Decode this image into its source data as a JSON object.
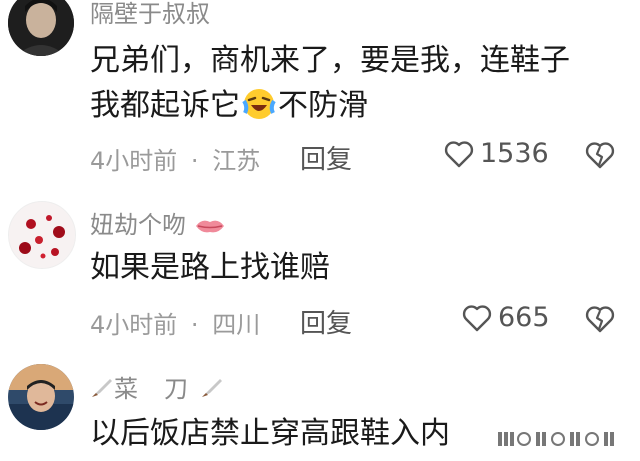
{
  "comments": [
    {
      "username": "隔壁于叔叔",
      "line1": "兄弟们，商机来了，要是我，连鞋子",
      "line2_before": "我都起诉它",
      "line2_after": "不防滑",
      "inline_emoji": "laughing-crying-emoji",
      "time": "4小时前",
      "location": "江苏",
      "reply_label": "回复",
      "likes": "1536"
    },
    {
      "username": "妞劫个吻",
      "username_icon": "red-lips-icon",
      "text": "如果是路上找谁赔",
      "time": "4小时前",
      "location": "四川",
      "reply_label": "回复",
      "likes": "665"
    },
    {
      "username": "菜刀",
      "username_icons": "knife-icon",
      "text": "以后饭店禁止穿高跟鞋入内"
    }
  ],
  "meta_separator": "·",
  "colors": {
    "text": "#1a1a1a",
    "meta": "#9a9a9a",
    "icon": "#555555"
  }
}
